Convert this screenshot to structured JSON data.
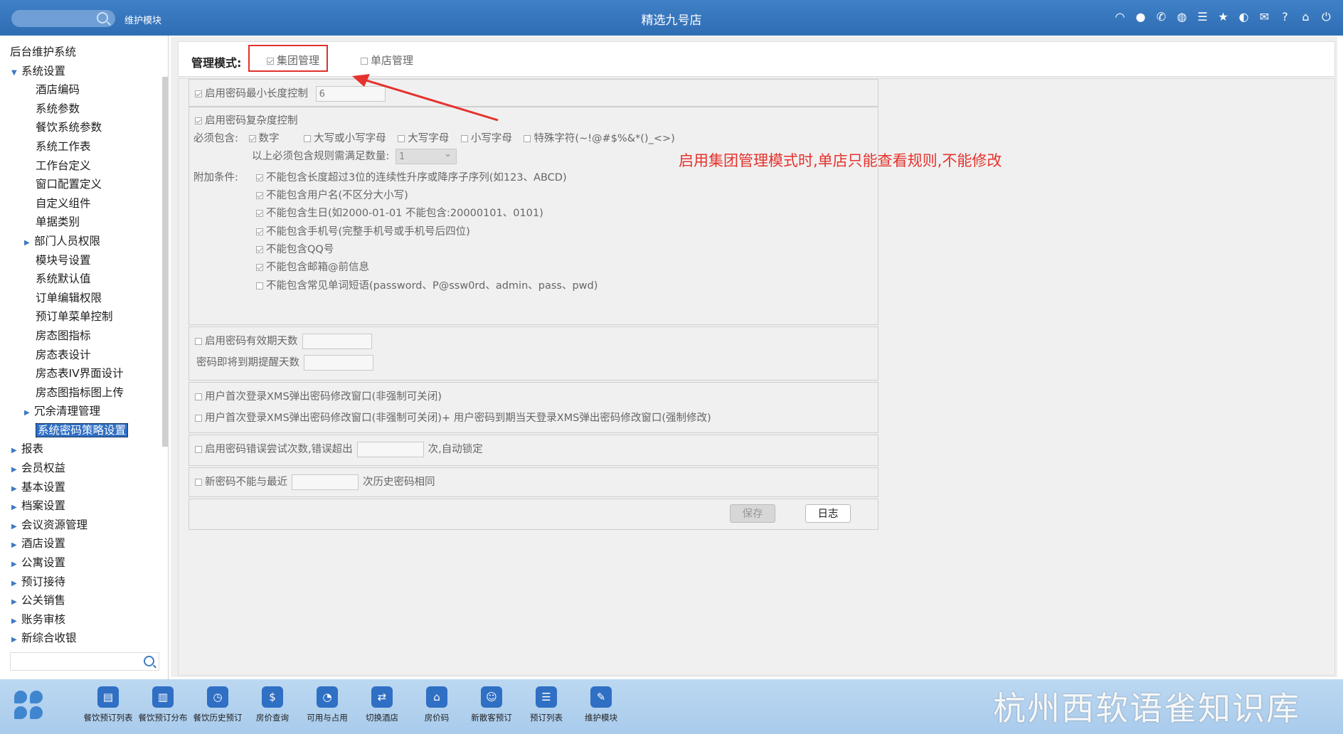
{
  "topbar": {
    "module": "维护模块",
    "title": "精选九号店",
    "icons": [
      "wifi-icon",
      "chat-icon",
      "phone-icon",
      "palette-icon",
      "menu-icon",
      "star-icon",
      "contrast-icon",
      "mail-icon",
      "help-icon",
      "home-icon",
      "power-icon"
    ]
  },
  "sidebar": {
    "root": "后台维护系统",
    "items": [
      {
        "label": "系统设置",
        "level": "l1",
        "expand": "down"
      },
      {
        "label": "酒店编码",
        "level": "l2"
      },
      {
        "label": "系统参数",
        "level": "l2"
      },
      {
        "label": "餐饮系统参数",
        "level": "l2"
      },
      {
        "label": "系统工作表",
        "level": "l2"
      },
      {
        "label": "工作台定义",
        "level": "l2"
      },
      {
        "label": "窗口配置定义",
        "level": "l2"
      },
      {
        "label": "自定义组件",
        "level": "l2"
      },
      {
        "label": "单据类别",
        "level": "l2"
      },
      {
        "label": "部门人员权限",
        "level": "l2b",
        "expand": "right"
      },
      {
        "label": "模块号设置",
        "level": "l2"
      },
      {
        "label": "系统默认值",
        "level": "l2"
      },
      {
        "label": "订单编辑权限",
        "level": "l2"
      },
      {
        "label": "预订单菜单控制",
        "level": "l2"
      },
      {
        "label": "房态图指标",
        "level": "l2"
      },
      {
        "label": "房态表设计",
        "level": "l2"
      },
      {
        "label": "房态表IV界面设计",
        "level": "l2"
      },
      {
        "label": "房态图指标图上传",
        "level": "l2"
      },
      {
        "label": "冗余清理管理",
        "level": "l2b",
        "expand": "right"
      },
      {
        "label": "系统密码策略设置",
        "level": "l2",
        "selected": true
      },
      {
        "label": "报表",
        "level": "l1",
        "expand": "right"
      },
      {
        "label": "会员权益",
        "level": "l1",
        "expand": "right"
      },
      {
        "label": "基本设置",
        "level": "l1",
        "expand": "right"
      },
      {
        "label": "档案设置",
        "level": "l1",
        "expand": "right"
      },
      {
        "label": "会议资源管理",
        "level": "l1",
        "expand": "right"
      },
      {
        "label": "酒店设置",
        "level": "l1",
        "expand": "right"
      },
      {
        "label": "公寓设置",
        "level": "l1",
        "expand": "right"
      },
      {
        "label": "预订接待",
        "level": "l1",
        "expand": "right"
      },
      {
        "label": "公关销售",
        "level": "l1",
        "expand": "right"
      },
      {
        "label": "账务审核",
        "level": "l1",
        "expand": "right"
      },
      {
        "label": "新综合收银",
        "level": "l1",
        "expand": "right"
      }
    ]
  },
  "mode": {
    "label": "管理模式:",
    "group": "集团管理",
    "single": "单店管理"
  },
  "policy": {
    "min_len_label": "启用密码最小长度控制",
    "min_len_value": "6",
    "complex_label": "启用密码复杂度控制",
    "must_include": "必须包含:",
    "opt_digit": "数字",
    "opt_case": "大写或小写字母",
    "opt_upper": "大写字母",
    "opt_lower": "小写字母",
    "opt_special": "特殊字符(~!@#$%&*()_<>)",
    "min_rules_label": "以上必须包含规则需满足数量:",
    "min_rules_value": "1",
    "extra_label": "附加条件:",
    "extra1": "不能包含长度超过3位的连续性升序或降序子序列(如123、ABCD)",
    "extra2": "不能包含用户名(不区分大小写)",
    "extra3": "不能包含生日(如2000-01-01 不能包含:20000101、0101)",
    "extra4": "不能包含手机号(完整手机号或手机号后四位)",
    "extra5": "不能包含QQ号",
    "extra6": "不能包含邮箱@前信息",
    "extra7": "不能包含常见单词短语(password、P@ssw0rd、admin、pass、pwd)",
    "valid_days_label": "启用密码有效期天数",
    "remind_days_label": "密码即将到期提醒天数",
    "first_login1": "用户首次登录XMS弹出密码修改窗口(非强制可关闭)",
    "first_login2": "用户首次登录XMS弹出密码修改窗口(非强制可关闭)+ 用户密码到期当天登录XMS弹出密码修改窗口(强制修改)",
    "lock_label": "启用密码错误尝试次数,错误超出",
    "lock_suffix": "次,自动锁定",
    "history_label": "新密码不能与最近",
    "history_suffix": "次历史密码相同",
    "save": "保存",
    "log": "日志"
  },
  "annotation": "启用集团管理模式时,单店只能查看规则,不能修改",
  "dock": [
    {
      "label": "餐饮预订列表",
      "icon": "clipboard-icon",
      "glyph": "▤"
    },
    {
      "label": "餐饮预订分布",
      "icon": "distribution-icon",
      "glyph": "▥"
    },
    {
      "label": "餐饮历史预订",
      "icon": "clock-icon",
      "glyph": "◷"
    },
    {
      "label": "房价查询",
      "icon": "price-search-icon",
      "glyph": "$"
    },
    {
      "label": "可用与占用",
      "icon": "pie-icon",
      "glyph": "◔"
    },
    {
      "label": "切换酒店",
      "icon": "switch-icon",
      "glyph": "⇄"
    },
    {
      "label": "房价码",
      "icon": "house-icon",
      "glyph": "⌂"
    },
    {
      "label": "新散客预订",
      "icon": "guest-icon",
      "glyph": "☺"
    },
    {
      "label": "预订列表",
      "icon": "list-icon",
      "glyph": "☰"
    },
    {
      "label": "维护模块",
      "icon": "wrench-icon",
      "glyph": "✎"
    }
  ],
  "watermark": "杭州西软语雀知识库"
}
